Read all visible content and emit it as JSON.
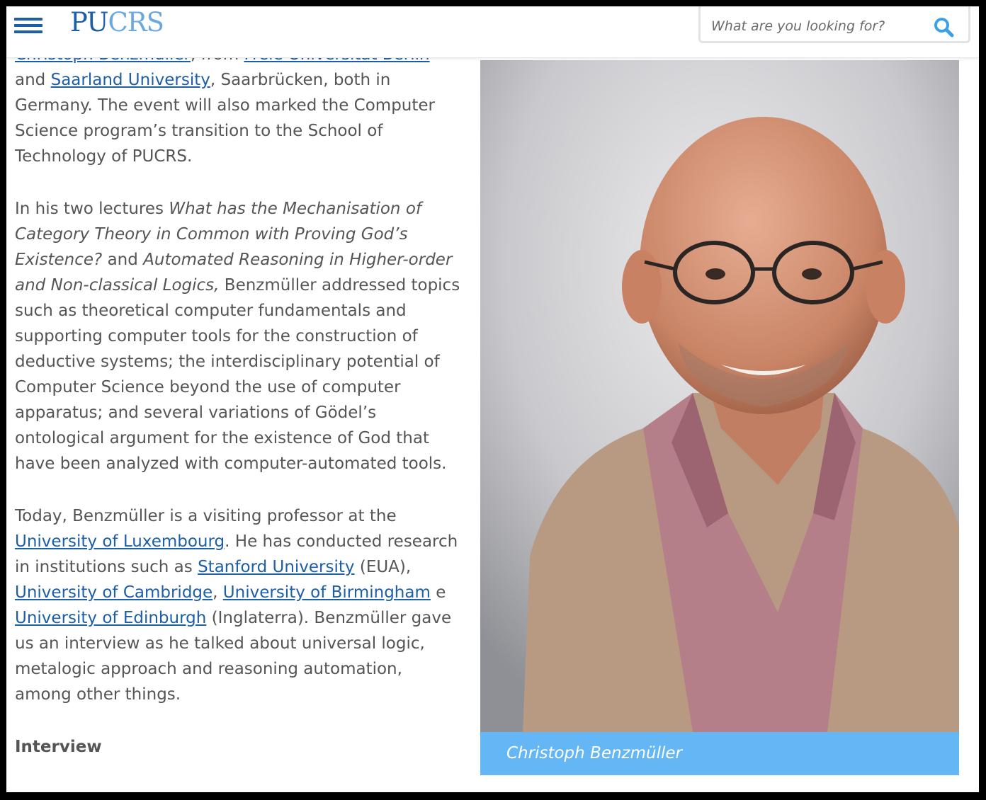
{
  "header": {
    "logo_pu": "PU",
    "logo_crs": "CRS",
    "search_placeholder": "What are you looking for?"
  },
  "article": {
    "p1": {
      "link_person": "Christoph Benzmüller",
      "t1": ", from ",
      "link_fub": "Freie Universität Berlin",
      "t2": " and ",
      "link_saarland": "Saarland University",
      "t3": ", Saarbrücken, both in Germany. The event will also marked the Computer Science program’s transition to the School of Technology of PUCRS."
    },
    "p2": {
      "t1": "In his two lectures ",
      "title1": "What has the Mechanisation of Category Theory in Common with Proving God’s Existence?",
      "t2": " and ",
      "title2": "Automated Reasoning in Higher-order and Non-classical Logics,",
      "t3": " Benzmüller addressed topics such as theoretical computer fundamentals and supporting computer tools for the construction of deductive systems; the interdisciplinary potential of Computer Science beyond the use of computer apparatus; and several variations of Gödel’s ontological argument for the existence of God that have been analyzed with computer-automated tools."
    },
    "p3": {
      "t1": "Today, Benzmüller is a visiting professor at the ",
      "link_lux": "University of Luxembourg",
      "t2": ". He has conducted research in institutions such as ",
      "link_stanford": "Stanford University",
      "t3": " (EUA), ",
      "link_cambridge": "University of Cambridge",
      "t4": ", ",
      "link_birmingham": "University of Birmingham",
      "t5": " e ",
      "link_edinburgh": "University of Edinburgh",
      "t6": " (Inglaterra). Benzmüller gave us an interview as he talked about universal logic, metalogic approach and reasoning automation, among other things."
    },
    "heading": "Interview"
  },
  "figure": {
    "caption": "Christoph Benzmüller"
  },
  "colors": {
    "link": "#1c5fa7",
    "caption_bg": "#64b6f5",
    "text": "#555555"
  },
  "icons": {
    "menu": "hamburger-menu-icon",
    "search": "search-icon"
  }
}
